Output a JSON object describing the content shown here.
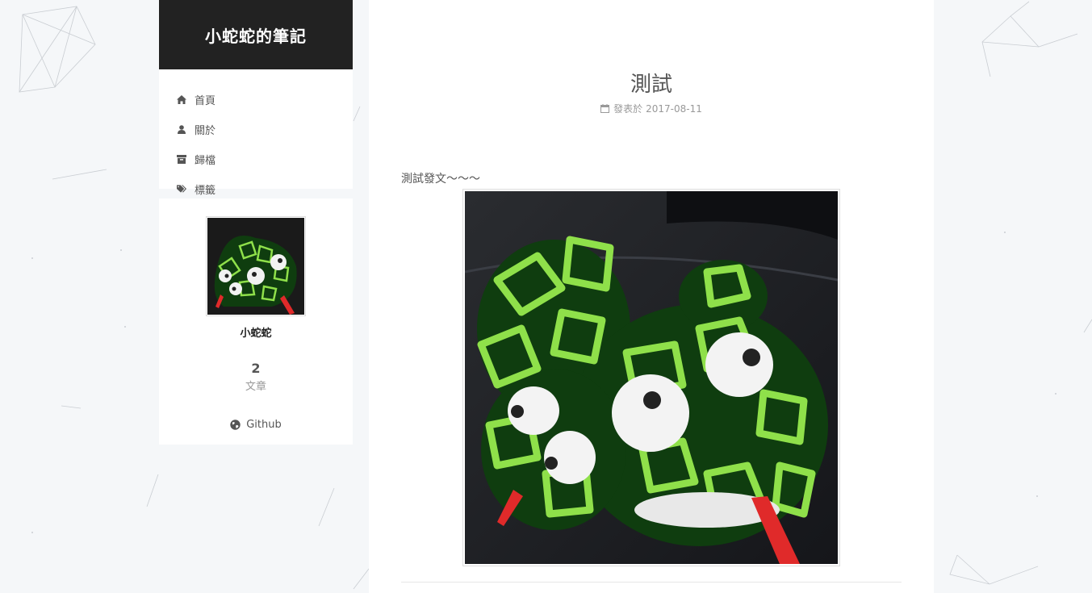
{
  "site": {
    "title": "小蛇蛇的筆記"
  },
  "menu": {
    "items": [
      {
        "label": "首頁",
        "icon": "home-icon"
      },
      {
        "label": "關於",
        "icon": "user-icon"
      },
      {
        "label": "歸檔",
        "icon": "archive-icon"
      },
      {
        "label": "標籤",
        "icon": "tags-icon"
      }
    ]
  },
  "profile": {
    "name": "小蛇蛇",
    "post_count": "2",
    "post_count_label": "文章",
    "github_label": "Github"
  },
  "post": {
    "title": "測試",
    "meta_label": "發表於",
    "date": "2017-08-11",
    "body": "測試發文～～～"
  },
  "colors": {
    "brand_bg": "#222222",
    "page_bg": "#f5f7f9",
    "snake_dark": "#0f3d0f",
    "snake_light": "#8fe04a",
    "tongue": "#e02a2a"
  }
}
